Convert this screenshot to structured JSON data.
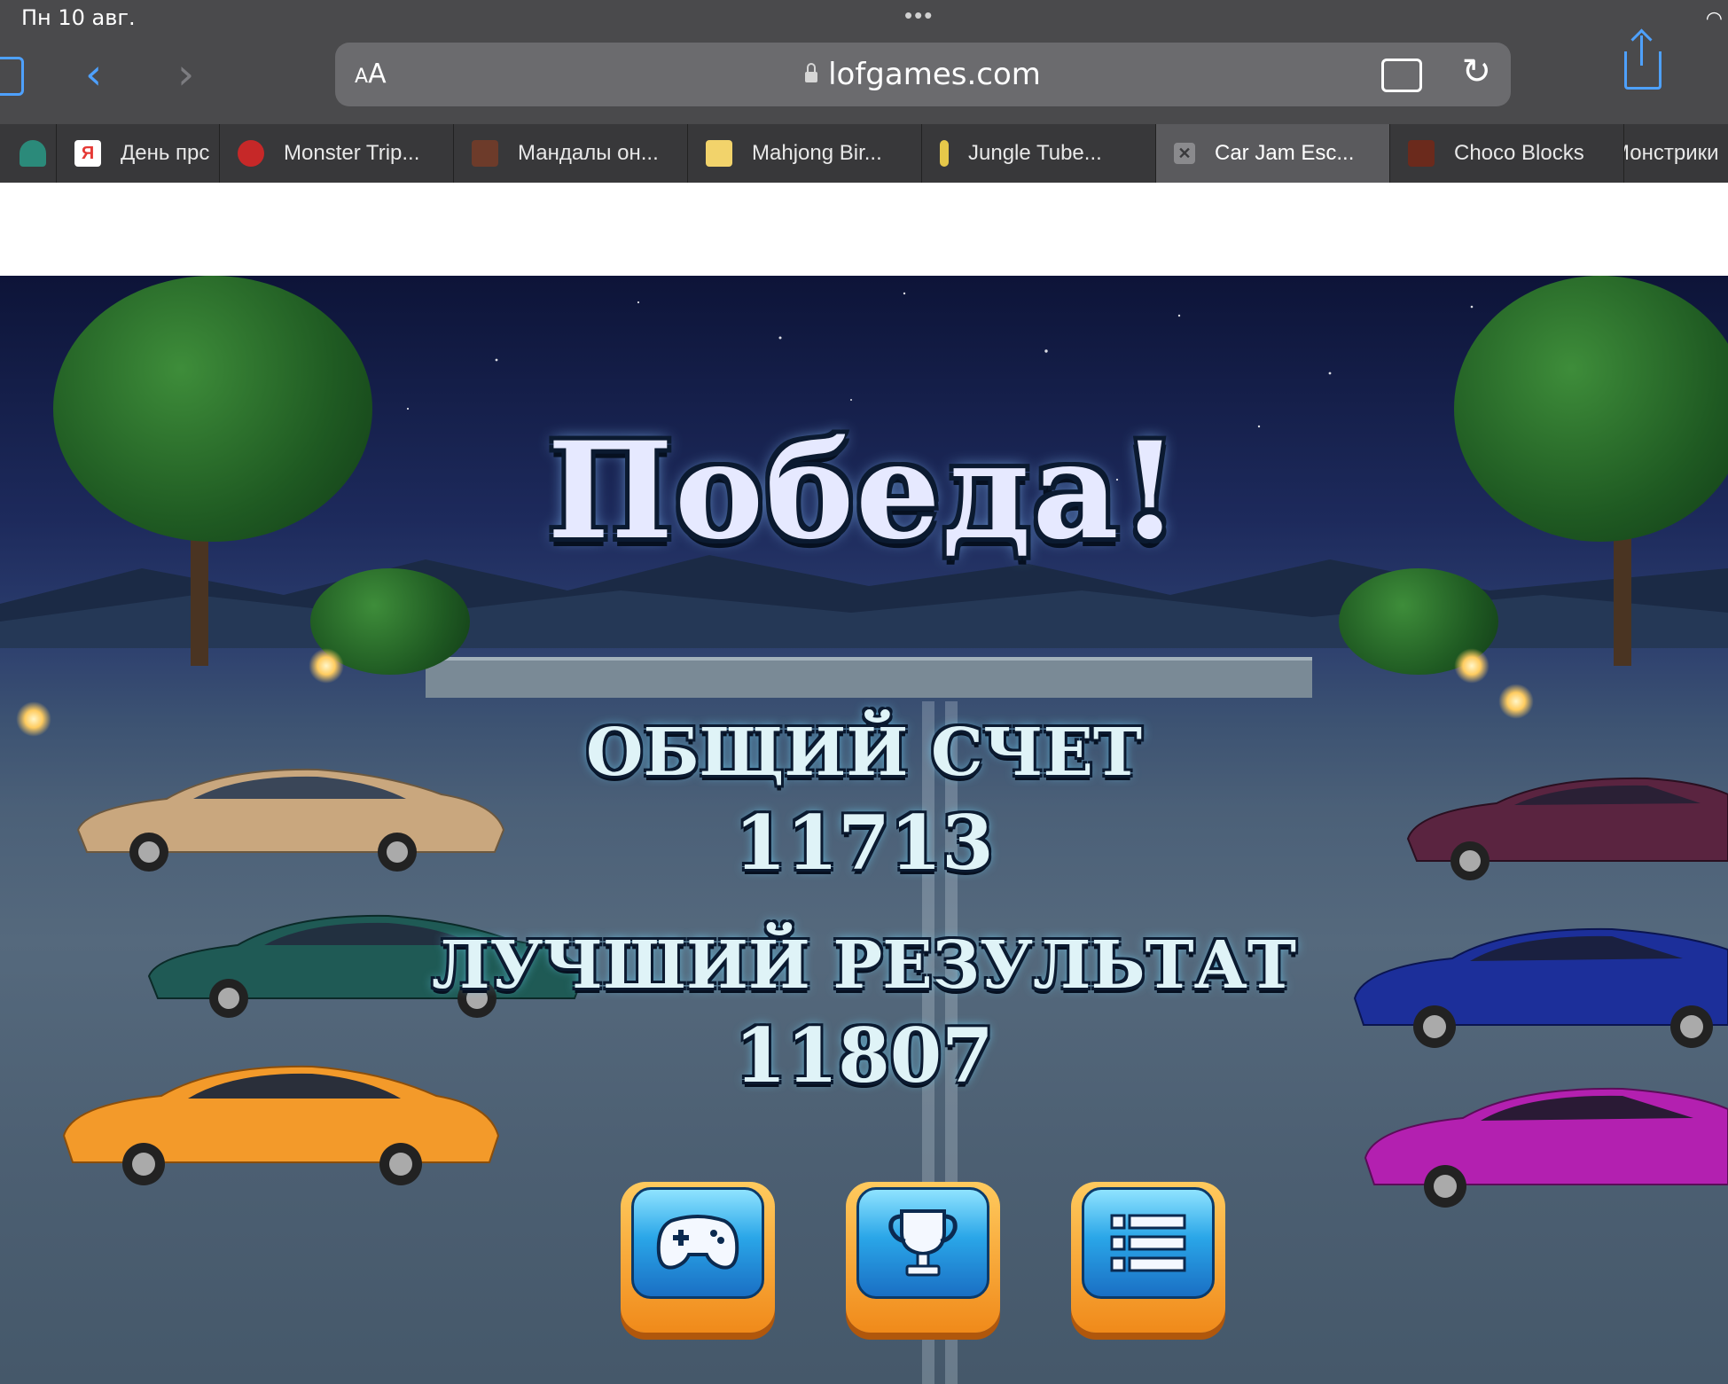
{
  "status_bar": {
    "time": "Пн 10 авг."
  },
  "toolbar": {
    "aa_label_small": "A",
    "aa_label_large": "A",
    "url": "lofgames.com"
  },
  "tabs": [
    {
      "label": "",
      "favicon_color": "#2b8a7a",
      "icon": "cupcake-icon"
    },
    {
      "label": "День прс",
      "favicon_color": "#e53935",
      "icon": "yandex-icon",
      "favicon_text": "Я"
    },
    {
      "label": "Monster Trip...",
      "favicon_color": "#c62828",
      "icon": "monster-icon"
    },
    {
      "label": "Мандалы он...",
      "favicon_color": "#6d3b2a",
      "icon": "mandala-icon"
    },
    {
      "label": "Mahjong Bir...",
      "favicon_color": "#f2d36b",
      "icon": "mahjong-icon"
    },
    {
      "label": "Jungle Tube...",
      "favicon_color": "#e6c84a",
      "icon": "jungle-icon"
    },
    {
      "label": "Car Jam Esc...",
      "favicon_color": "#6b6b6e",
      "icon": "close-icon",
      "active": true
    },
    {
      "label": "Choco Blocks",
      "favicon_color": "#6b2a1c",
      "icon": "choco-icon"
    },
    {
      "label": "Монстрики",
      "favicon_color": "#38383a",
      "icon": ""
    }
  ],
  "game": {
    "title": "Победа!",
    "total_score_label": "ОБЩИЙ СЧЕТ",
    "total_score_value": "11713",
    "best_result_label": "ЛУЧШИЙ РЕЗУЛЬТАТ",
    "best_result_value": "11807",
    "buttons": [
      {
        "name": "play-again-button",
        "icon": "gamepad-icon"
      },
      {
        "name": "leaderboard-button",
        "icon": "trophy-icon"
      },
      {
        "name": "menu-button",
        "icon": "list-icon"
      }
    ],
    "cars": [
      {
        "side": "left",
        "color": "#c9a77e"
      },
      {
        "side": "left",
        "color": "#1f5a55"
      },
      {
        "side": "left",
        "color": "#f39a2a"
      },
      {
        "side": "right",
        "color": "#5a2440"
      },
      {
        "side": "right",
        "color": "#1c2f9a"
      },
      {
        "side": "right",
        "color": "#b320b0"
      }
    ]
  }
}
